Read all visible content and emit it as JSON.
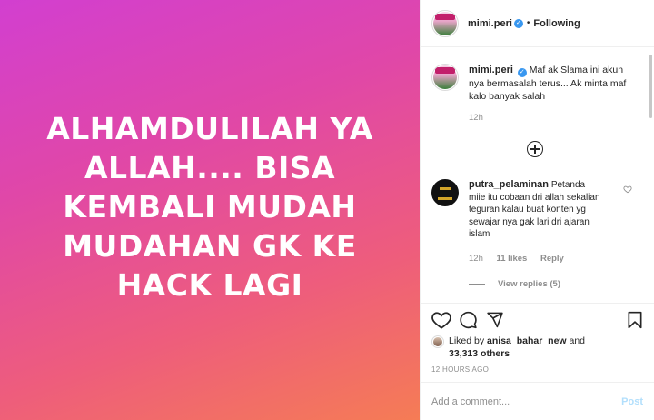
{
  "media": {
    "text": "ALHAMDULILAH YA ALLAH.... BISA KEMBALI MUDAH MUDAHAN GK KE HACK LAGI",
    "gradient_colors": [
      "#d23fd0",
      "#ee5d7c",
      "#f57c55"
    ]
  },
  "header": {
    "username": "mimi.peri",
    "verified": true,
    "separator": "•",
    "follow_status": "Following"
  },
  "caption": {
    "username": "mimi.peri",
    "text": "Maf ak Slama ini akun nya bermasalah terus... Ak minta maf kalo banyak salah",
    "time": "12h"
  },
  "load_more_icon": "plus-circle-icon",
  "reply_comment": {
    "username": "putra_pelaminan",
    "text": "Petanda miie itu cobaan dri allah sekalian teguran kalau buat konten yg sewajar nya gak lari dri ajaran islam",
    "time": "12h",
    "likes": "11 likes",
    "reply_label": "Reply",
    "view_replies": "View replies (5)"
  },
  "actions": {
    "icons": [
      "heart-icon",
      "comment-icon",
      "share-icon",
      "bookmark-icon"
    ]
  },
  "likes": {
    "prefix": "Liked by",
    "user": "anisa_bahar_new",
    "and": "and",
    "others": "33,313 others"
  },
  "timestamp": "12 HOURS AGO",
  "add_comment": {
    "placeholder": "Add a comment...",
    "post_label": "Post"
  },
  "colors": {
    "verified_blue": "#3897f0",
    "post_button_disabled": "#b2dffc",
    "muted_text": "#8e8e8e"
  }
}
